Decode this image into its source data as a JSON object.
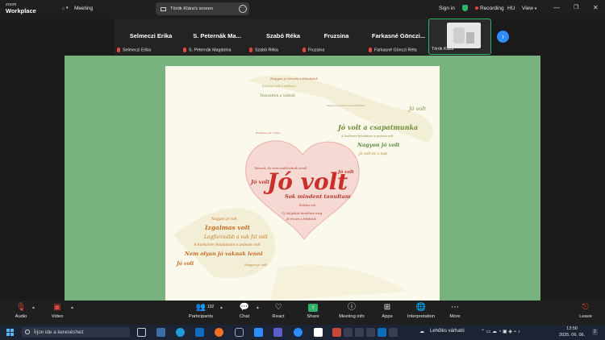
{
  "app": {
    "logo_line1": "zoom",
    "logo_line2": "Workplace",
    "meeting_label": "Meeting",
    "share_pill": "Török Klára's screen",
    "sign_in": "Sign in",
    "recording": "Recording",
    "lang": "HU",
    "view": "View"
  },
  "participants": [
    {
      "name": "Selmeczi Erika",
      "label": "Selmeczi Erika"
    },
    {
      "name": "S. Peternák Ma...",
      "label": "S. Peternák Magdolna"
    },
    {
      "name": "Szabó Réka",
      "label": "Szabó Réka"
    },
    {
      "name": "Fruzsina",
      "label": "Fruzsina"
    },
    {
      "name": "Farkasné Gönczi...",
      "label": "Farkasné Gönczi Réta"
    },
    {
      "name": "",
      "label": "Török Klára"
    }
  ],
  "slide": {
    "main": "Jó volt",
    "phrases": [
      "Nagyon jó érezés a feladatok",
      "Érdekes volt a módszer",
      "Tetszettek a videók",
      "Nagyon jó volt a csoportmunka",
      "Jó volt",
      "Jó volt a csapatmunka",
      "A harkonre feladatoan a pulsuis volt",
      "Nagyon jó volt",
      "Jó volt ez a nap",
      "Érdekes volt a téma",
      "Tetszett, de nem unatkoztunk ennél",
      "Sok mindent tanultam",
      "Jó volt",
      "Jó volt",
      "Nagyon jó volt",
      "Izgalmas volt",
      "Legfurcsább a vak fal volt",
      "A harkonre feladatoan a pulsuis volt",
      "Nem olyan jó vaknak lenni",
      "Jó volt",
      "Nagyon jó volt",
      "Új dolgokat tanultam meg",
      "Jó érezés a feladatok",
      "Érdekes volt"
    ]
  },
  "toolbar": {
    "audio": "Audio",
    "video": "Video",
    "participants": "Participants",
    "participants_count": "102",
    "chat": "Chat",
    "react": "React",
    "share": "Share",
    "meeting_info": "Meeting info",
    "apps": "Apps",
    "interpretation": "Interpretation",
    "more": "More",
    "leave": "Leave"
  },
  "taskbar": {
    "search_placeholder": "Írjon ide a kereséshez",
    "weather": "Lehűlés várható",
    "time": "13:50",
    "date": "2025. 06. 06.",
    "notif_count": "2"
  },
  "colors": {
    "accent_green": "#2fb36a",
    "share_bg": "#78b27e",
    "blue": "#2d8cff",
    "heart_red": "#d63a33"
  }
}
